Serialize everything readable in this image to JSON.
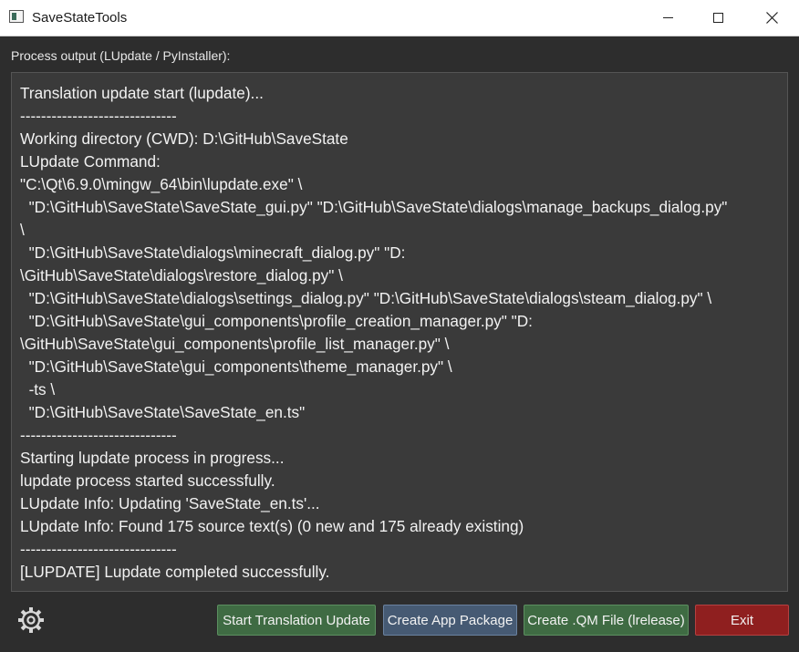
{
  "window": {
    "title": "SaveStateTools",
    "minimize_icon": "minimize-icon",
    "maximize_icon": "maximize-icon",
    "close_icon": "close-icon"
  },
  "output_section": {
    "label": "Process output (LUpdate / PyInstaller):",
    "lines": [
      "Translation update start (lupdate)...",
      "------------------------------",
      "Working directory (CWD): D:\\GitHub\\SaveState",
      "LUpdate Command:",
      "\"C:\\Qt\\6.9.0\\mingw_64\\bin\\lupdate.exe\" \\",
      "  \"D:\\GitHub\\SaveState\\SaveState_gui.py\" \"D:\\GitHub\\SaveState\\dialogs\\manage_backups_dialog.py\"",
      "\\",
      "  \"D:\\GitHub\\SaveState\\dialogs\\minecraft_dialog.py\" \"D:",
      "\\GitHub\\SaveState\\dialogs\\restore_dialog.py\" \\",
      "  \"D:\\GitHub\\SaveState\\dialogs\\settings_dialog.py\" \"D:\\GitHub\\SaveState\\dialogs\\steam_dialog.py\" \\",
      "  \"D:\\GitHub\\SaveState\\gui_components\\profile_creation_manager.py\" \"D:",
      "\\GitHub\\SaveState\\gui_components\\profile_list_manager.py\" \\",
      "  \"D:\\GitHub\\SaveState\\gui_components\\theme_manager.py\" \\",
      "  -ts \\",
      "  \"D:\\GitHub\\SaveState\\SaveState_en.ts\"",
      "------------------------------",
      "Starting lupdate process in progress...",
      "lupdate process started successfully.",
      "LUpdate Info: Updating 'SaveState_en.ts'...",
      "LUpdate Info: Found 175 source text(s) (0 new and 175 already existing)",
      "------------------------------",
      "[LUPDATE] Lupdate completed successfully."
    ]
  },
  "toolbar": {
    "settings_icon": "gear-icon",
    "start_translation_label": "Start Translation Update",
    "create_package_label": "Create App Package",
    "create_qm_label": "Create .QM File (lrelease)",
    "exit_label": "Exit"
  },
  "colors": {
    "background": "#2d2d2d",
    "output_background": "#3a3a3a",
    "green_button": "#3f6b43",
    "blue_button": "#465a73",
    "exit_button": "#8f1f1f"
  }
}
